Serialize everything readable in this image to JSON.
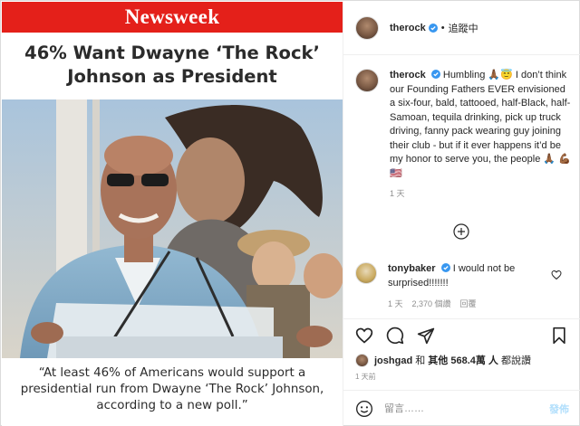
{
  "media": {
    "brand": "Newsweek",
    "headline": "46% Want Dwayne ‘The Rock’ Johnson as President",
    "quote": "“At least 46% of Americans would support a presidential run from Dwayne ‘The Rock’ Johnson, according to a new poll.”",
    "colors": {
      "brand_red": "#e4201a"
    }
  },
  "header": {
    "username": "therock",
    "separator": "•",
    "follow_status": "追蹤中"
  },
  "caption": {
    "username": "therock",
    "text": "Humbling 🙏🏾😇 I don’t think our Founding Fathers EVER envisioned a six-four, bald, tattooed, half-Black, half-Samoan, tequila drinking, pick up truck driving, fanny pack wearing guy joining their club - but if it ever happens it’d be my honor to serve you, the people 🙏🏾 💪🏾🇺🇸",
    "age": "1 天"
  },
  "comment": {
    "username": "tonybaker",
    "text": "I would not be surprised!!!!!!!",
    "age": "1 天",
    "likes": "2,370 個讚",
    "reply": "回覆"
  },
  "likes": {
    "user": "joshgad",
    "joiner": "和",
    "others": "其他 568.4萬 人",
    "suffix": "都說讚"
  },
  "post_age": "1 天前",
  "add_comment": {
    "placeholder": "留言……",
    "post_label": "發佈"
  },
  "icons": [
    "ellipsis-icon",
    "verified-icon",
    "heart-icon",
    "comment-icon",
    "share-icon",
    "bookmark-icon",
    "plus-circle-icon",
    "smile-icon"
  ]
}
